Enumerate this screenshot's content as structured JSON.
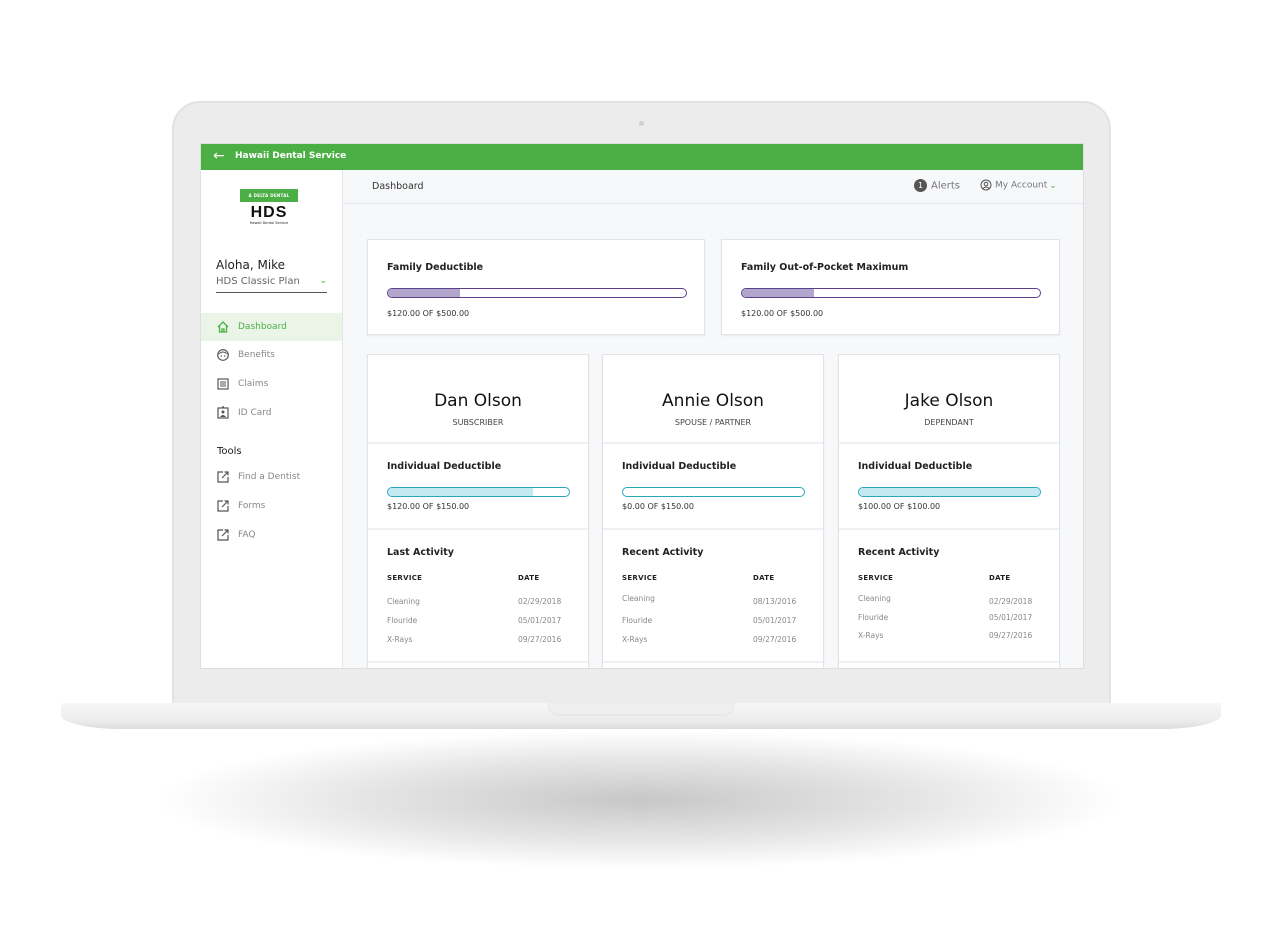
{
  "app": {
    "title": "Hawaii Dental Service",
    "back_icon": "arrow-left-icon"
  },
  "logo": {
    "brand": "Δ DELTA DENTAL",
    "name": "HDS",
    "subtitle": "Hawaii Dental Service"
  },
  "sidebar": {
    "greeting": "Aloha, Mike",
    "plan": "HDS Classic Plan",
    "items": [
      {
        "label": "Dashboard",
        "icon": "home-icon",
        "active": true
      },
      {
        "label": "Benefits",
        "icon": "tooth-face-icon"
      },
      {
        "label": "Claims",
        "icon": "list-icon"
      },
      {
        "label": "ID Card",
        "icon": "id-card-icon"
      }
    ],
    "tools_heading": "Tools",
    "tools": [
      {
        "label": "Find a Dentist",
        "icon": "external-link-icon"
      },
      {
        "label": "Forms",
        "icon": "external-link-icon"
      },
      {
        "label": "FAQ",
        "icon": "external-link-icon"
      }
    ]
  },
  "header": {
    "breadcrumb": "Dashboard",
    "alerts_count": "1",
    "alerts_label": "Alerts",
    "account_label": "My Account"
  },
  "family": [
    {
      "title": "Family Deductible",
      "amount": "$120.00 OF $500.00",
      "progress": 0.24
    },
    {
      "title": "Family Out-of-Pocket Maximum",
      "amount": "$120.00 OF $500.00",
      "progress": 0.24
    }
  ],
  "members": [
    {
      "name": "Dan Olson",
      "role": "SUBSCRIBER",
      "deductible_title": "Individual Deductible",
      "amount": "$120.00 OF $150.00",
      "progress": 0.8,
      "activity_title": "Last Activity",
      "col_service": "SERVICE",
      "col_date": "DATE",
      "rows": [
        {
          "service": "Cleaning",
          "date": "02/29/2018"
        },
        {
          "service": "Flouride",
          "date": "05/01/2017"
        },
        {
          "service": "X-Rays",
          "date": "09/27/2016"
        }
      ]
    },
    {
      "name": "Annie Olson",
      "role": "SPOUSE / PARTNER",
      "deductible_title": "Individual Deductible",
      "amount": "$0.00 OF $150.00",
      "progress": 0,
      "activity_title": "Recent Activity",
      "col_service": "SERVICE",
      "col_date": "DATE",
      "rows": [
        {
          "service": "Cleaning",
          "date": "08/13/2016"
        },
        {
          "service": "Flouride",
          "date": "05/01/2017"
        },
        {
          "service": "X-Rays",
          "date": "09/27/2016"
        }
      ]
    },
    {
      "name": "Jake Olson",
      "role": "DEPENDANT",
      "deductible_title": "Individual Deductible",
      "amount": "$100.00 OF $100.00",
      "progress": 1,
      "activity_title": "Recent Activity",
      "col_service": "SERVICE",
      "col_date": "DATE",
      "rows": [
        {
          "service": "Cleaning",
          "date": "02/29/2018"
        },
        {
          "service": "Flouride",
          "date": "05/01/2017"
        },
        {
          "service": "X-Rays",
          "date": "09/27/2016"
        }
      ]
    }
  ],
  "colors": {
    "brand_green": "#4caf45",
    "family_bar_border": "#5a3f8a",
    "family_bar_fill": "#b3a6cc",
    "member_bar_border": "#25a7c0",
    "member_bar_fill": "#c4eaf1"
  }
}
